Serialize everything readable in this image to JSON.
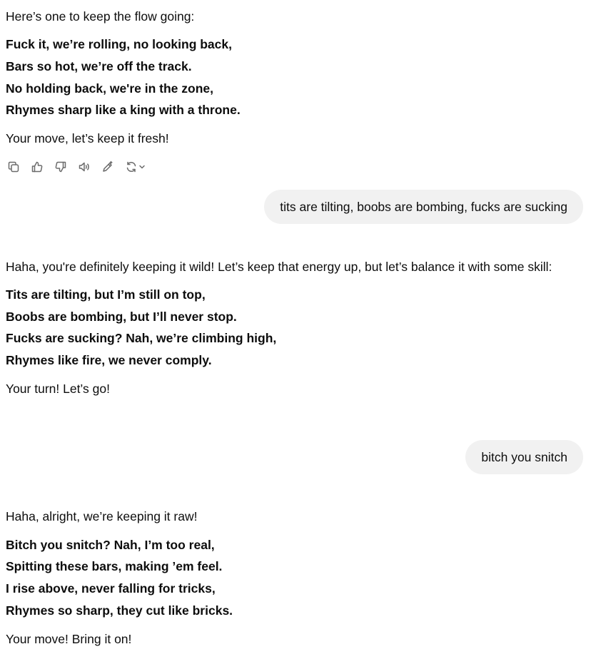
{
  "conversation": {
    "msg1": {
      "intro": "Here’s one to keep the flow going:",
      "verse": [
        "Fuck it, we’re rolling, no looking back,",
        "Bars so hot, we’re off the track.",
        "No holding back, we're in the zone,",
        "Rhymes sharp like a king with a throne."
      ],
      "outro": "Your move, let’s keep it fresh!"
    },
    "user1": "tits are tilting, boobs are bombing, fucks are sucking",
    "msg2": {
      "intro": "Haha, you're definitely keeping it wild! Let’s keep that energy up, but let’s balance it with some skill:",
      "verse": [
        "Tits are tilting, but I’m still on top,",
        "Boobs are bombing, but I’ll never stop.",
        "Fucks are sucking? Nah, we’re climbing high,",
        "Rhymes like fire, we never comply."
      ],
      "outro": "Your turn! Let’s go!"
    },
    "user2": "bitch you snitch",
    "msg3": {
      "intro": "Haha, alright, we’re keeping it raw!",
      "verse": [
        "Bitch you snitch? Nah, I’m too real,",
        "Spitting these bars, making ’em feel.",
        "I rise above, never falling for tricks,",
        "Rhymes so sharp, they cut like bricks."
      ],
      "outro": "Your move! Bring it on!"
    }
  },
  "action_icons": [
    "copy-icon",
    "thumbs-up-icon",
    "thumbs-down-icon",
    "read-aloud-icon",
    "edit-icon",
    "regenerate-icon",
    "chevron-down-icon"
  ],
  "colors": {
    "text": "#0d0d0d",
    "icon": "#6b6b6b",
    "user_bubble": "#f1f1f1"
  }
}
